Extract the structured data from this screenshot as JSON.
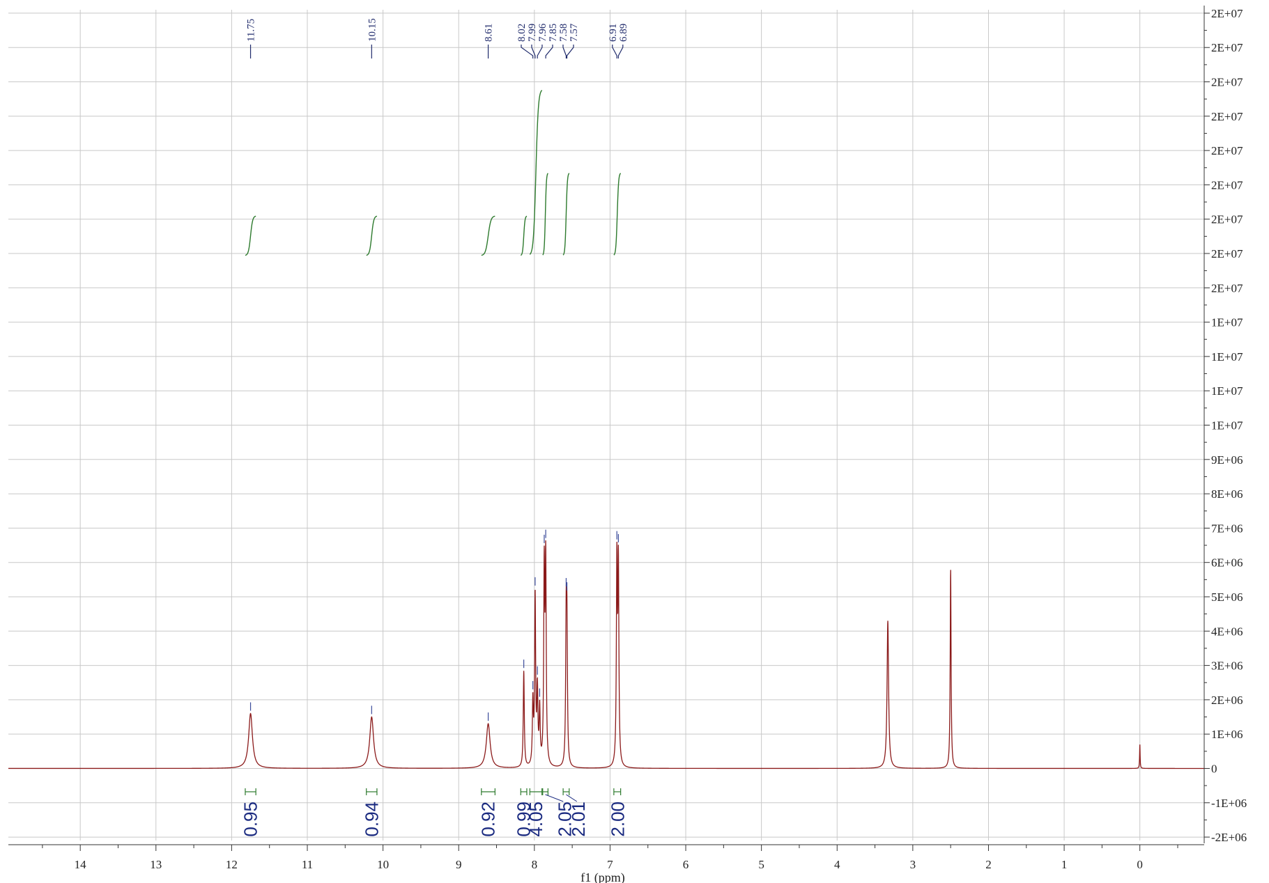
{
  "chart_data": {
    "type": "line",
    "xlabel": "f1 (ppm)",
    "xlim": [
      14.95,
      -0.85
    ],
    "ylim": [
      -2100000,
      22100000
    ],
    "x_ticks": [
      14,
      13,
      12,
      11,
      10,
      9,
      8,
      7,
      6,
      5,
      4,
      3,
      2,
      1,
      0
    ],
    "y_ticks": [
      {
        "value": 22000000,
        "label": "2E+07"
      },
      {
        "value": 21000000,
        "label": "2E+07"
      },
      {
        "value": 20000000,
        "label": "2E+07"
      },
      {
        "value": 19000000,
        "label": "2E+07"
      },
      {
        "value": 18000000,
        "label": "2E+07"
      },
      {
        "value": 17000000,
        "label": "2E+07"
      },
      {
        "value": 16000000,
        "label": "2E+07"
      },
      {
        "value": 15000000,
        "label": "2E+07"
      },
      {
        "value": 14000000,
        "label": "2E+07"
      },
      {
        "value": 13000000,
        "label": "1E+07"
      },
      {
        "value": 12000000,
        "label": "1E+07"
      },
      {
        "value": 11000000,
        "label": "1E+07"
      },
      {
        "value": 10000000,
        "label": "1E+07"
      },
      {
        "value": 9000000,
        "label": "9E+06"
      },
      {
        "value": 8000000,
        "label": "8E+06"
      },
      {
        "value": 7000000,
        "label": "7E+06"
      },
      {
        "value": 6000000,
        "label": "6E+06"
      },
      {
        "value": 5000000,
        "label": "5E+06"
      },
      {
        "value": 4000000,
        "label": "4E+06"
      },
      {
        "value": 3000000,
        "label": "3E+06"
      },
      {
        "value": 2000000,
        "label": "2E+06"
      },
      {
        "value": 1000000,
        "label": "1E+06"
      },
      {
        "value": 0,
        "label": "0"
      },
      {
        "value": -1000000,
        "label": "-1E+06"
      },
      {
        "value": -2000000,
        "label": "-2E+06"
      }
    ],
    "grid": true,
    "spectrum_color": "#8b1a1a",
    "integral_color": "#2d7a2d",
    "label_color": "#1f2a6b",
    "peaks": [
      {
        "ppm": 11.75,
        "height": 1600000,
        "width": 0.03
      },
      {
        "ppm": 10.15,
        "height": 1500000,
        "width": 0.03
      },
      {
        "ppm": 8.61,
        "height": 1300000,
        "width": 0.03
      },
      {
        "ppm": 8.14,
        "height": 2800000,
        "width": 0.008
      },
      {
        "ppm": 8.02,
        "height": 1800000,
        "width": 0.008
      },
      {
        "ppm": 7.99,
        "height": 4900000,
        "width": 0.008
      },
      {
        "ppm": 7.96,
        "height": 2100000,
        "width": 0.008
      },
      {
        "ppm": 7.93,
        "height": 1600000,
        "width": 0.008
      },
      {
        "ppm": 7.87,
        "height": 5600000,
        "width": 0.008
      },
      {
        "ppm": 7.85,
        "height": 5800000,
        "width": 0.008
      },
      {
        "ppm": 7.58,
        "height": 3800000,
        "width": 0.008
      },
      {
        "ppm": 7.57,
        "height": 3600000,
        "width": 0.008
      },
      {
        "ppm": 6.91,
        "height": 5800000,
        "width": 0.008
      },
      {
        "ppm": 6.89,
        "height": 5700000,
        "width": 0.008
      },
      {
        "ppm": 3.33,
        "height": 4300000,
        "width": 0.012
      },
      {
        "ppm": 2.5,
        "height": 5800000,
        "width": 0.007
      },
      {
        "ppm": 0.0,
        "height": 700000,
        "width": 0.004
      }
    ],
    "peak_labels": [
      {
        "text": "11.75",
        "ppm": 11.75
      },
      {
        "text": "10.15",
        "ppm": 10.15
      },
      {
        "text": "8.61",
        "ppm": 8.61
      },
      {
        "text": "8.02",
        "ppm": 8.02
      },
      {
        "text": "7.99",
        "ppm": 7.99
      },
      {
        "text": "7.96",
        "ppm": 7.96
      },
      {
        "text": "7.85",
        "ppm": 7.85
      },
      {
        "text": "7.58",
        "ppm": 7.58
      },
      {
        "text": "7.57",
        "ppm": 7.57
      },
      {
        "text": "6.91",
        "ppm": 6.91
      },
      {
        "text": "6.89",
        "ppm": 6.89
      }
    ],
    "integrals": [
      {
        "from": 11.82,
        "to": 11.68,
        "value": "0.95",
        "label_ppm": 11.75
      },
      {
        "from": 10.22,
        "to": 10.08,
        "value": "0.94",
        "label_ppm": 10.15
      },
      {
        "from": 8.7,
        "to": 8.52,
        "value": "0.92",
        "label_ppm": 8.61
      },
      {
        "from": 8.18,
        "to": 8.1,
        "value": "0.99",
        "label_ppm": 8.14
      },
      {
        "from": 8.06,
        "to": 7.9,
        "value": "4.05",
        "label_ppm": 7.98
      },
      {
        "from": 7.89,
        "to": 7.82,
        "value": "2.05",
        "label_ppm": 7.6
      },
      {
        "from": 7.62,
        "to": 7.54,
        "value": "2.01",
        "label_ppm": 7.42
      },
      {
        "from": 6.95,
        "to": 6.86,
        "value": "2.00",
        "label_ppm": 6.9
      }
    ]
  }
}
